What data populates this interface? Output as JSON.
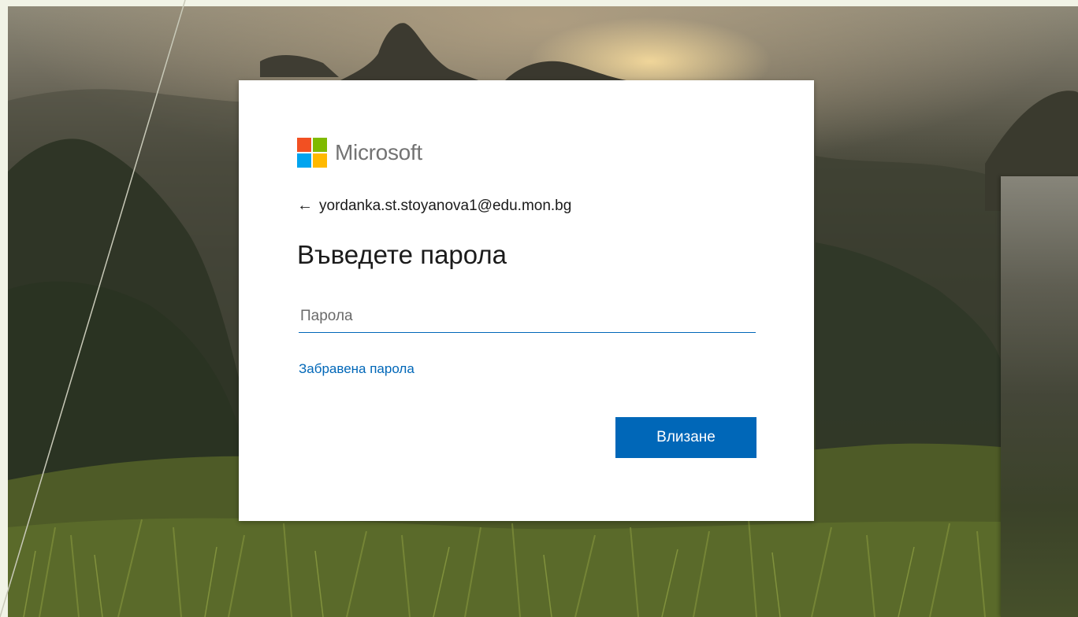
{
  "brand": {
    "name": "Microsoft",
    "logo_colors": [
      "#f25022",
      "#7fba00",
      "#00a4ef",
      "#ffb900"
    ]
  },
  "account": {
    "back_icon": "arrow-left-icon",
    "email": "yordanka.st.stoyanova1@edu.mon.bg"
  },
  "heading": "Въведете парола",
  "password": {
    "value": "",
    "placeholder": "Парола"
  },
  "forgot_link": "Забравена парола",
  "signin_button": "Влизане",
  "colors": {
    "accent": "#0067b8",
    "card": "#ffffff"
  }
}
